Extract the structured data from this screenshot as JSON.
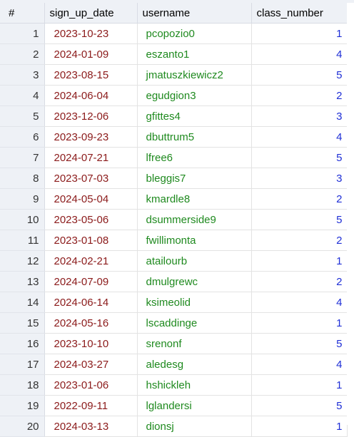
{
  "columns": {
    "index": "#",
    "sign_up_date": "sign_up_date",
    "username": "username",
    "class_number": "class_number"
  },
  "colors": {
    "date_text": "#8b1a1a",
    "username_text": "#1f8a1f",
    "number_text": "#1f2fd6",
    "header_bg": "#eef1f6"
  },
  "rows": [
    {
      "idx": "1",
      "sign_up_date": "2023-10-23",
      "username": "pcopozio0",
      "class_number": "1"
    },
    {
      "idx": "2",
      "sign_up_date": "2024-01-09",
      "username": "eszanto1",
      "class_number": "4"
    },
    {
      "idx": "3",
      "sign_up_date": "2023-08-15",
      "username": "jmatuszkiewicz2",
      "class_number": "5"
    },
    {
      "idx": "4",
      "sign_up_date": "2024-06-04",
      "username": "egudgion3",
      "class_number": "2"
    },
    {
      "idx": "5",
      "sign_up_date": "2023-12-06",
      "username": "gfittes4",
      "class_number": "3"
    },
    {
      "idx": "6",
      "sign_up_date": "2023-09-23",
      "username": "dbuttrum5",
      "class_number": "4"
    },
    {
      "idx": "7",
      "sign_up_date": "2024-07-21",
      "username": "lfree6",
      "class_number": "5"
    },
    {
      "idx": "8",
      "sign_up_date": "2023-07-03",
      "username": "bleggis7",
      "class_number": "3"
    },
    {
      "idx": "9",
      "sign_up_date": "2024-05-04",
      "username": "kmardle8",
      "class_number": "2"
    },
    {
      "idx": "10",
      "sign_up_date": "2023-05-06",
      "username": "dsummerside9",
      "class_number": "5"
    },
    {
      "idx": "11",
      "sign_up_date": "2023-01-08",
      "username": "fwillimonta",
      "class_number": "2"
    },
    {
      "idx": "12",
      "sign_up_date": "2024-02-21",
      "username": "atailourb",
      "class_number": "1"
    },
    {
      "idx": "13",
      "sign_up_date": "2024-07-09",
      "username": "dmulgrewc",
      "class_number": "2"
    },
    {
      "idx": "14",
      "sign_up_date": "2024-06-14",
      "username": "ksimeolid",
      "class_number": "4"
    },
    {
      "idx": "15",
      "sign_up_date": "2024-05-16",
      "username": "lscaddinge",
      "class_number": "1"
    },
    {
      "idx": "16",
      "sign_up_date": "2023-10-10",
      "username": "srenonf",
      "class_number": "5"
    },
    {
      "idx": "17",
      "sign_up_date": "2024-03-27",
      "username": "aledesg",
      "class_number": "4"
    },
    {
      "idx": "18",
      "sign_up_date": "2023-01-06",
      "username": "hshickleh",
      "class_number": "1"
    },
    {
      "idx": "19",
      "sign_up_date": "2022-09-11",
      "username": "lglandersi",
      "class_number": "5"
    },
    {
      "idx": "20",
      "sign_up_date": "2024-03-13",
      "username": "dionsj",
      "class_number": "1"
    }
  ]
}
